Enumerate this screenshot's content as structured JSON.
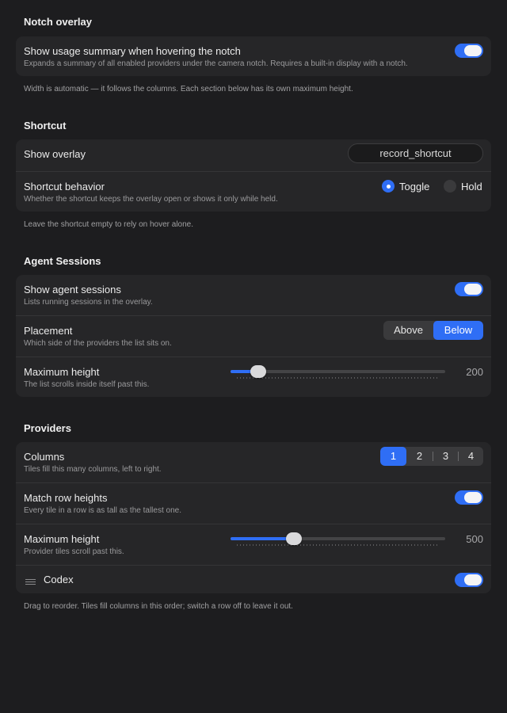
{
  "notch": {
    "title": "Notch overlay",
    "summary_title": "Show usage summary when hovering the notch",
    "summary_sub": "Expands a summary of all enabled providers under the camera notch. Requires a built-in display with a notch.",
    "summary_enabled": true,
    "note": "Width is automatic — it follows the columns. Each section below has its own maximum height."
  },
  "shortcut": {
    "title": "Shortcut",
    "show_overlay_label": "Show overlay",
    "shortcut_value": "record_shortcut",
    "behavior_title": "Shortcut behavior",
    "behavior_sub": "Whether the shortcut keeps the overlay open or shows it only while held.",
    "option_toggle": "Toggle",
    "option_hold": "Hold",
    "selected": "Toggle",
    "note": "Leave the shortcut empty to rely on hover alone."
  },
  "agent": {
    "title": "Agent Sessions",
    "show_title": "Show agent sessions",
    "show_sub": "Lists running sessions in the overlay.",
    "show_enabled": true,
    "placement_title": "Placement",
    "placement_sub": "Which side of the providers the list sits on.",
    "placement_above": "Above",
    "placement_below": "Below",
    "placement_selected": "Below",
    "maxh_title": "Maximum height",
    "maxh_sub": "The list scrolls inside itself past this.",
    "maxh_value": "200",
    "maxh_fraction": 0.1
  },
  "providers": {
    "title": "Providers",
    "columns_title": "Columns",
    "columns_sub": "Tiles fill this many columns, left to right.",
    "columns_options": [
      "1",
      "2",
      "3",
      "4"
    ],
    "columns_selected": "1",
    "match_title": "Match row heights",
    "match_sub": "Every tile in a row is as tall as the tallest one.",
    "match_enabled": true,
    "maxh_title": "Maximum height",
    "maxh_sub": "Provider tiles scroll past this.",
    "maxh_value": "500",
    "maxh_fraction": 0.28,
    "codex_label": "Codex",
    "codex_enabled": true,
    "note": "Drag to reorder. Tiles fill columns in this order; switch a row off to leave it out."
  },
  "colors": {
    "accent": "#2f6ef5",
    "background": "#1d1d1f",
    "card": "#262628"
  }
}
